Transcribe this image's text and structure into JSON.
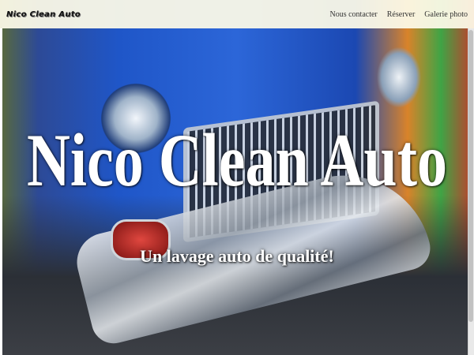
{
  "navbar": {
    "brand": "Nico Clean Auto",
    "links": [
      {
        "label": "Nous contacter"
      },
      {
        "label": "Réserver"
      },
      {
        "label": "Galerie photo"
      }
    ]
  },
  "hero": {
    "title": "Nico Clean Auto",
    "subtitle": "Un lavage auto de qualité!"
  },
  "colors": {
    "navbar_bg": "#fcfae8",
    "car_blue": "#1f56c8",
    "text_white": "#ffffff"
  }
}
